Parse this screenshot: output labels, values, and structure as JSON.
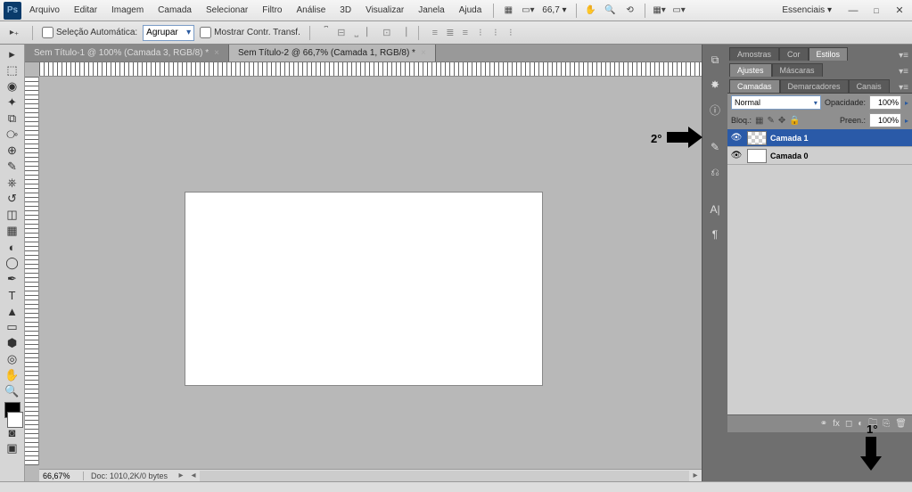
{
  "menu": {
    "items": [
      "Arquivo",
      "Editar",
      "Imagem",
      "Camada",
      "Selecionar",
      "Filtro",
      "Análise",
      "3D",
      "Visualizar",
      "Janela",
      "Ajuda"
    ],
    "zoom": "66,7",
    "workspace": "Essenciais"
  },
  "optbar": {
    "auto_select": "Seleção Automática:",
    "group": "Agrupar",
    "show_transform": "Mostrar Contr. Transf."
  },
  "tabs": [
    {
      "label": "Sem Título-1 @ 100% (Camada 3, RGB/8) *"
    },
    {
      "label": "Sem Título-2 @ 66,7% (Camada 1, RGB/8) *"
    }
  ],
  "status": {
    "zoom": "66,67%",
    "doc": "Doc: 1010,2K/0 bytes"
  },
  "panels": {
    "top_tabs": [
      "Amostras",
      "Cor",
      "Estilos"
    ],
    "mid_tabs": [
      "Ajustes",
      "Máscaras"
    ],
    "layer_tabs": [
      "Camadas",
      "Demarcadores",
      "Canais"
    ],
    "blend_mode": "Normal",
    "opacity_label": "Opacidade:",
    "opacity": "100%",
    "lock_label": "Bloq.:",
    "fill_label": "Preen.:",
    "fill": "100%",
    "layers": [
      {
        "name": "Camada 1"
      },
      {
        "name": "Camada 0"
      }
    ]
  },
  "annotations": {
    "a1": "1°",
    "a2": "2°"
  }
}
